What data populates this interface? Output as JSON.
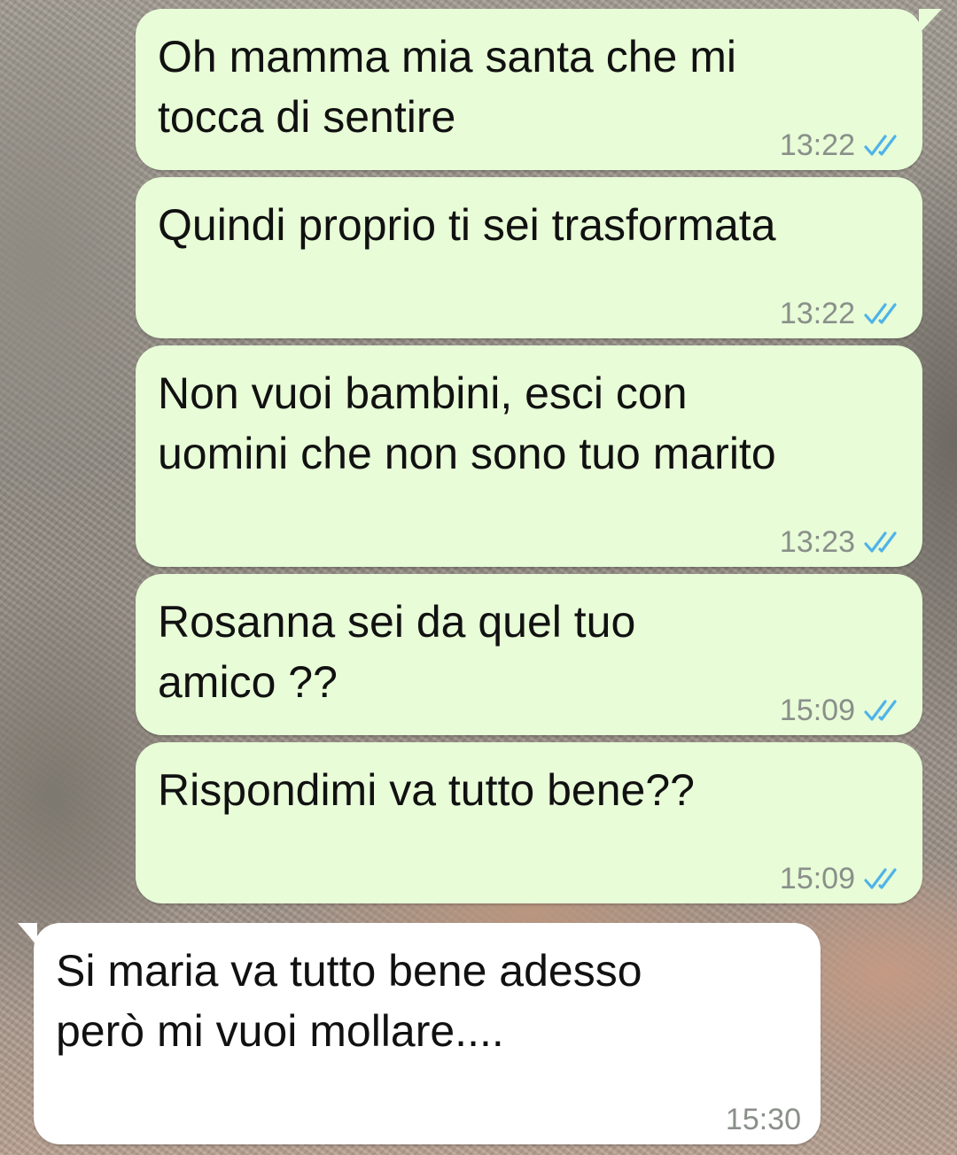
{
  "colors": {
    "outgoing_bubble": "#e7fcd7",
    "incoming_bubble": "#ffffff",
    "read_tick": "#4fb3e8",
    "timestamp": "#8a8f8a"
  },
  "messages": [
    {
      "direction": "outgoing",
      "text_line_1": "Oh mamma mia santa che mi",
      "text_line_2": "tocca di sentire",
      "time": "13:22",
      "status": "read-double-check-icon"
    },
    {
      "direction": "outgoing",
      "text_line_1": "Quindi proprio ti sei trasformata",
      "time": "13:22",
      "status": "read-double-check-icon"
    },
    {
      "direction": "outgoing",
      "text_line_1": "Non vuoi bambini, esci con",
      "text_line_2": "uomini che non sono tuo marito",
      "time": "13:23",
      "status": "read-double-check-icon"
    },
    {
      "direction": "outgoing",
      "text_line_1": "Rosanna sei da quel tuo",
      "text_line_2": "amico ??",
      "time": "15:09",
      "status": "read-double-check-icon"
    },
    {
      "direction": "outgoing",
      "text_line_1": "Rispondimi va tutto bene??",
      "time": "15:09",
      "status": "read-double-check-icon"
    },
    {
      "direction": "incoming",
      "text_line_1": "Si maria va tutto bene adesso",
      "text_line_2": "però mi vuoi mollare....",
      "time": "15:30"
    }
  ]
}
